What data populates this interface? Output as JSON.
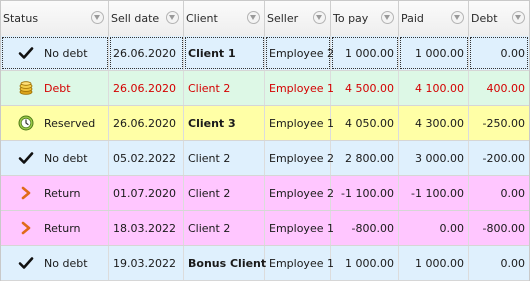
{
  "header": {
    "status": "Status",
    "sell_date": "Sell date",
    "client": "Client",
    "seller": "Seller",
    "to_pay": "To pay",
    "paid": "Paid",
    "debt": "Debt"
  },
  "colors": {
    "no_debt": "#dff0fd",
    "debt": "#ddf8e6",
    "reserved": "#ffffa6",
    "return": "#ffc6ff",
    "red_text": "#d40000"
  },
  "rows": [
    {
      "icon": "checkmark-icon",
      "status": "No debt",
      "sell_date": "26.06.2020",
      "client": "Client 1",
      "seller": "Employee 2",
      "to_pay": "1 000.00",
      "paid": "1 000.00",
      "debt": "0.00"
    },
    {
      "icon": "coins-icon",
      "status": "Debt",
      "sell_date": "26.06.2020",
      "client": "Client 2",
      "seller": "Employee 1",
      "to_pay": "4 500.00",
      "paid": "4 100.00",
      "debt": "400.00"
    },
    {
      "icon": "clock-icon",
      "status": "Reserved",
      "sell_date": "26.06.2020",
      "client": "Client 3",
      "seller": "Employee 1",
      "to_pay": "4 050.00",
      "paid": "4 300.00",
      "debt": "-250.00"
    },
    {
      "icon": "checkmark-icon",
      "status": "No debt",
      "sell_date": "05.02.2022",
      "client": "Client 2",
      "seller": "Employee 2",
      "to_pay": "2 800.00",
      "paid": "3 000.00",
      "debt": "-200.00"
    },
    {
      "icon": "return-arrow-icon",
      "status": "Return",
      "sell_date": "01.07.2020",
      "client": "Client 2",
      "seller": "Employee 2",
      "to_pay": "-1 100.00",
      "paid": "-1 100.00",
      "debt": "0.00"
    },
    {
      "icon": "return-arrow-icon",
      "status": "Return",
      "sell_date": "18.03.2022",
      "client": "Client 2",
      "seller": "Employee 1",
      "to_pay": "-800.00",
      "paid": "0.00",
      "debt": "-800.00"
    },
    {
      "icon": "checkmark-icon",
      "status": "No debt",
      "sell_date": "19.03.2022",
      "client": "Bonus Client",
      "seller": "Employee 1",
      "to_pay": "1 000.00",
      "paid": "1 000.00",
      "debt": "0.00"
    }
  ]
}
